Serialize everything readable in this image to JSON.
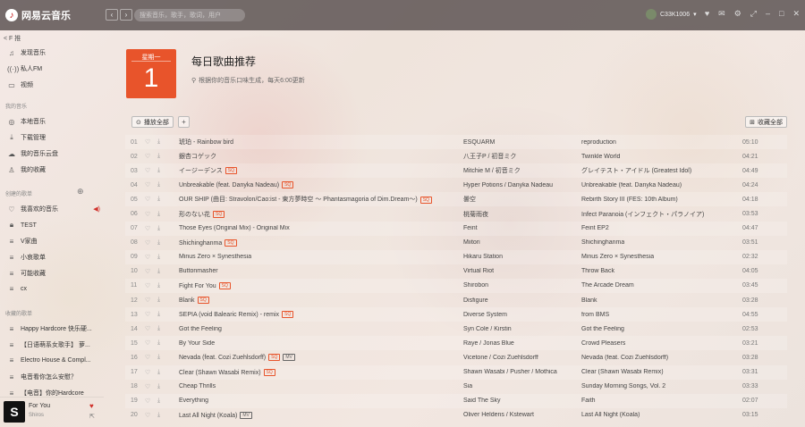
{
  "app": {
    "name": "网易云音乐"
  },
  "topbar": {
    "search_placeholder": "搜索音乐，歌手，歌词，用户",
    "user_name": "C33K1006"
  },
  "sidebar": {
    "head": "< F 推",
    "items_top": [
      {
        "label": "发现音乐",
        "icon": "music-note-icon"
      },
      {
        "label": "私人FM",
        "icon": "radio-icon"
      },
      {
        "label": "视频",
        "icon": "video-icon"
      }
    ],
    "section_my": "我的音乐",
    "items_my": [
      {
        "label": "本地音乐",
        "icon": "disc-icon"
      },
      {
        "label": "下载管理",
        "icon": "download-icon"
      },
      {
        "label": "我的音乐云盘",
        "icon": "cloud-icon"
      },
      {
        "label": "我的收藏",
        "icon": "user-icon"
      }
    ],
    "section_created": "创建的歌单",
    "items_created": [
      {
        "label": "我喜欢的音乐",
        "icon": "heart-icon"
      },
      {
        "label": "TEST",
        "icon": "lock-icon"
      },
      {
        "label": "V家曲",
        "icon": "playlist-icon"
      },
      {
        "label": "小哀歌单",
        "icon": "playlist-icon"
      },
      {
        "label": "可能收藏",
        "icon": "playlist-icon"
      },
      {
        "label": "cx",
        "icon": "playlist-icon"
      }
    ],
    "section_collected": "收藏的歌单",
    "items_collected": [
      {
        "label": "Happy Hardcore 快乐硬...",
        "icon": "playlist-icon"
      },
      {
        "label": "【日语萌系女歌手】 萝...",
        "icon": "playlist-icon"
      },
      {
        "label": "Electro House & Compl...",
        "icon": "playlist-icon"
      },
      {
        "label": "电音看你怎么安慰？",
        "icon": "playlist-icon"
      },
      {
        "label": "【电音】你的Hardcore",
        "icon": "playlist-icon"
      }
    ]
  },
  "player": {
    "title": "For You",
    "artist": "Shiros"
  },
  "header": {
    "weekday": "星期一",
    "day": "1",
    "title": "每日歌曲推荐",
    "subtitle": "根据你的音乐口味生成，每天6:00更新"
  },
  "toolbar": {
    "play_all": "播放全部",
    "collect_all": "收藏全部"
  },
  "songs": [
    {
      "no": "01",
      "title": "琥珀 - Rainbow bird",
      "tag": "",
      "artist": "ESQUARM",
      "album": "reproduction",
      "duration": "05:10"
    },
    {
      "no": "02",
      "title": "銀杏コゲック",
      "tag": "",
      "artist": "八王子P / 初音ミク",
      "album": "Twinkle World",
      "duration": "04:21"
    },
    {
      "no": "03",
      "title": "イージーデンス",
      "tag": "SQ",
      "artist": "Mitchie M / 初音ミク",
      "album": "グレイテスト・アイドル (Greatest Idol)",
      "duration": "04:49"
    },
    {
      "no": "04",
      "title": "Unbreakable (feat. Danyka Nadeau)",
      "tag": "SQ",
      "artist": "Hyper Potions / Danyka Nadeau",
      "album": "Unbreakable (feat. Danyka Nadeau)",
      "duration": "04:24"
    },
    {
      "no": "05",
      "title": "OUR SHIP (曲目: Stravolon/Cao:ist - 東方夢時空 ～ Phantasmagoria of Dim.Dream～)",
      "tag": "SQ",
      "artist": "曇空",
      "album": "Rebirth Story III (FES: 10th Album)",
      "duration": "04:18"
    },
    {
      "no": "06",
      "title": "形のない花",
      "tag": "SQ",
      "artist": "桃菊雨夜",
      "album": "Infect Paranoia (インフェクト・パラノイア)",
      "duration": "03:53"
    },
    {
      "no": "07",
      "title": "Those Eyes (Original Mix) - Original Mix",
      "tag": "",
      "artist": "Feint",
      "album": "Feint EP2",
      "duration": "04:47"
    },
    {
      "no": "08",
      "title": "Shichinghanma",
      "tag": "SQ",
      "artist": "Miitori",
      "album": "Shichinghanma",
      "duration": "03:51"
    },
    {
      "no": "09",
      "title": "Minus Zero × Synesthesia",
      "tag": "",
      "artist": "Hikaru Station",
      "album": "Minus Zero × Synesthesia",
      "duration": "02:32"
    },
    {
      "no": "10",
      "title": "Buttonmasher",
      "tag": "",
      "artist": "Virtual Riot",
      "album": "Throw Back",
      "duration": "04:05"
    },
    {
      "no": "11",
      "title": "Fight For You",
      "tag": "SQ",
      "artist": "Shirobon",
      "album": "The Arcade Dream",
      "duration": "03:45"
    },
    {
      "no": "12",
      "title": "Blank",
      "tag": "SQ",
      "artist": "Disfigure",
      "album": "Blank",
      "duration": "03:28"
    },
    {
      "no": "13",
      "title": "SEPIA (void Balearic Remix) - remix",
      "tag": "SQ",
      "artist": "Diverse System",
      "album": "from BMS",
      "duration": "04:55"
    },
    {
      "no": "14",
      "title": "Got the Feeling",
      "tag": "",
      "artist": "Syn Cole / Kirstin",
      "album": "Got the Feeling",
      "duration": "02:53"
    },
    {
      "no": "15",
      "title": "By Your Side",
      "tag": "",
      "artist": "Raye / Jonas Blue",
      "album": "Crowd Pleasers",
      "duration": "03:21"
    },
    {
      "no": "16",
      "title": "Nevada (feat. Cozi Zuehlsdorff)",
      "tag": "SQ MV",
      "artist": "Vicetone / Cozi Zuehlsdorff",
      "album": "Nevada (feat. Cozi Zuehlsdorff)",
      "duration": "03:28"
    },
    {
      "no": "17",
      "title": "Clear (Shawn Wasabi Remix)",
      "tag": "SQ",
      "artist": "Shawn Wasabi / Pusher / Mothica",
      "album": "Clear (Shawn Wasabi Remix)",
      "duration": "03:31"
    },
    {
      "no": "18",
      "title": "Cheap Thrills",
      "tag": "",
      "artist": "Sia",
      "album": "Sunday Morning Songs, Vol. 2",
      "duration": "03:33"
    },
    {
      "no": "19",
      "title": "Everything",
      "tag": "",
      "artist": "Said The Sky",
      "album": "Faith",
      "duration": "02:07"
    },
    {
      "no": "20",
      "title": "Last All Night (Koala)",
      "tag": "MV",
      "artist": "Oliver Heldens / Kstewart",
      "album": "Last All Night (Koala)",
      "duration": "03:15"
    }
  ]
}
